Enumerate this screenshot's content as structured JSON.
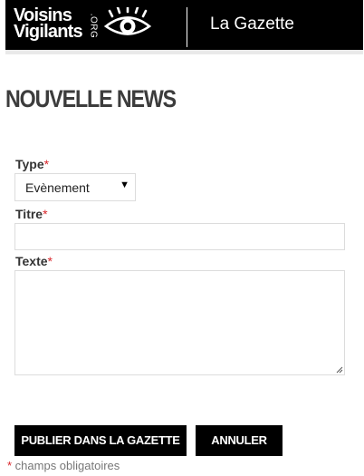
{
  "header": {
    "logo_line1": "Voisins",
    "logo_line2": "Vigilants",
    "logo_org": ".ORG",
    "section_title": "La Gazette"
  },
  "page_title": "NOUVELLE NEWS",
  "form": {
    "type": {
      "label": "Type",
      "required_mark": "*",
      "selected_value": "Evènement"
    },
    "title": {
      "label": "Titre",
      "required_mark": "*",
      "value": ""
    },
    "text": {
      "label": "Texte",
      "required_mark": "*",
      "value": ""
    }
  },
  "buttons": {
    "publish_label": "PUBLIER DANS LA GAZETTE",
    "cancel_label": "ANNULER"
  },
  "footer_note": {
    "mark": "*",
    "text": " champs obligatoires"
  },
  "colors": {
    "header_bg": "#000000",
    "required": "#d9262b",
    "button_bg": "#000000"
  },
  "icons": [
    "eye-logo-icon",
    "chevron-down-icon",
    "resize-grip-icon"
  ]
}
